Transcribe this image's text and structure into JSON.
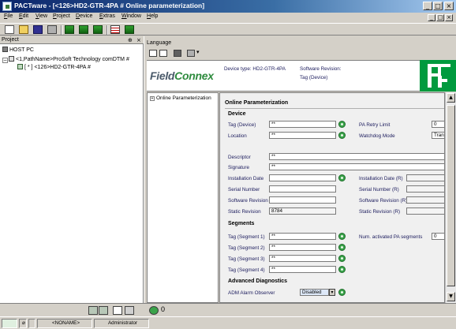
{
  "window": {
    "title": "PACTware - [<126>HD2-GTR-4PA # Online parameterization]",
    "minimize_glyph": "_",
    "maximize_glyph": "□",
    "close_glyph": "×"
  },
  "menu": [
    "File",
    "Edit",
    "View",
    "Project",
    "Device",
    "Extras",
    "Window",
    "Help"
  ],
  "project": {
    "header": "Project",
    "pin_glyph": "⊕",
    "close_glyph": "×",
    "tree": [
      {
        "label": "HOST PC"
      },
      {
        "label": "<1,PathName>ProSoft Technology comDTM #"
      },
      {
        "label": "[ * ] <126>HD2-GTR-4PA #"
      }
    ]
  },
  "dtm": {
    "language_label": "Language",
    "logo": {
      "part1": "Field",
      "part2": "Connex"
    },
    "device_type_label": "Device type: HD2-GTR-4PA",
    "software_revision_label": "Software Revision:",
    "tag_device_label": "Tag (Device)",
    "nav_item": "Online Parameterization"
  },
  "form": {
    "title": "Online Parameterization",
    "device_section": "Device",
    "tag_device": {
      "label": "Tag (Device)",
      "value": "**"
    },
    "location": {
      "label": "Location",
      "value": "**"
    },
    "pa_retry_limit": {
      "label": "PA Retry Limit",
      "value": "0"
    },
    "watchdog_mode": {
      "label": "Watchdog Mode",
      "value": "Trans"
    },
    "descriptor": {
      "label": "Descriptor",
      "value": "**"
    },
    "signature": {
      "label": "Signature",
      "value": "**"
    },
    "installation_date": {
      "label": "Installation Date",
      "value": ""
    },
    "installation_date_r": {
      "label": "Installation Date (R)",
      "value": ""
    },
    "serial_number": {
      "label": "Serial Number",
      "value": ""
    },
    "serial_number_r": {
      "label": "Serial Number (R)",
      "value": ""
    },
    "software_revision": {
      "label": "Software Revision",
      "value": ""
    },
    "software_revision_r": {
      "label": "Software Revision (R)",
      "value": ""
    },
    "static_revision": {
      "label": "Static Revision",
      "value": "8784"
    },
    "static_revision_r": {
      "label": "Static Revision (R)",
      "value": ""
    },
    "segments_section": "Segments",
    "segments": [
      {
        "label": "Tag (Segment 1)",
        "value": "**"
      },
      {
        "label": "Tag (Segment 2)",
        "value": "**"
      },
      {
        "label": "Tag (Segment 3)",
        "value": "**"
      },
      {
        "label": "Tag (Segment 4)",
        "value": "**"
      }
    ],
    "num_pa_segments": {
      "label": "Num. activated PA segments",
      "value": "0"
    },
    "adv_diag_section": "Advanced Diagnostics",
    "adm_alarm_observer": {
      "label": "ADM Alarm Observer",
      "value": "Disabled"
    }
  },
  "bottom_toolbar": {
    "counter": "0"
  },
  "status": {
    "connection": "",
    "bullet": "⌀",
    "project_name": "<NONAME>",
    "user": "Administrator"
  }
}
